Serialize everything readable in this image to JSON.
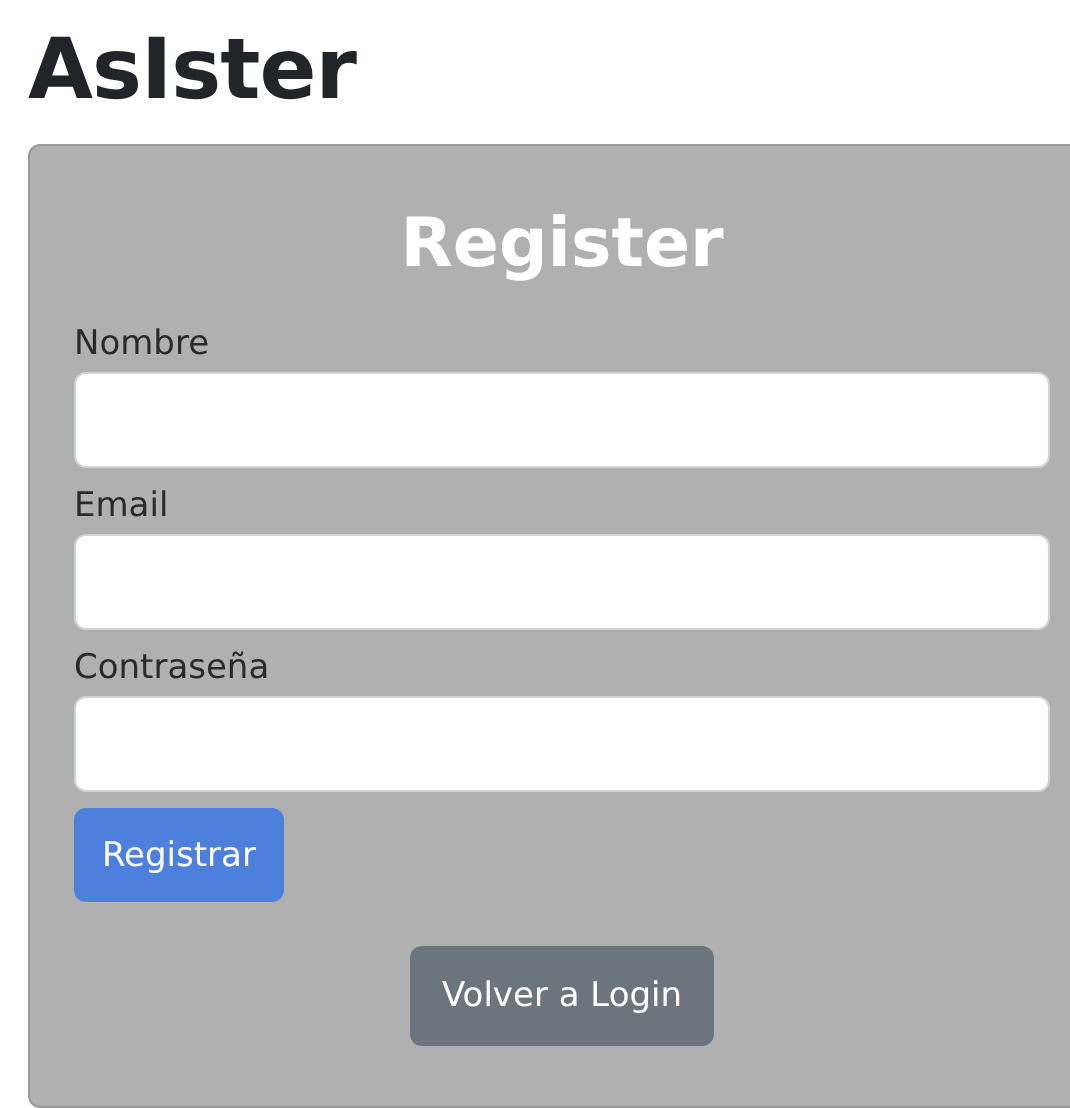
{
  "app_title": "AsIster",
  "form": {
    "title": "Register",
    "fields": [
      {
        "label": "Nombre"
      },
      {
        "label": "Email"
      },
      {
        "label": "Contraseña"
      }
    ],
    "submit": "Registrar",
    "back": "Volver a Login"
  }
}
